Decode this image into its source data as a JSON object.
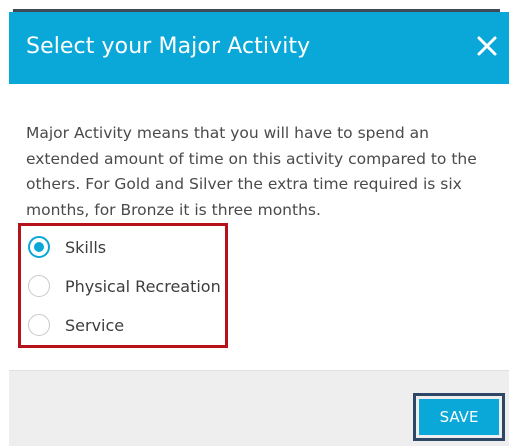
{
  "dialog": {
    "title": "Select your Major Activity",
    "close_icon": "close-icon",
    "description": "Major Activity means that you will have to spend an extended amount of time on this activity compared to the others. For Gold and Silver the extra time required is six months, for Bronze it is three months.",
    "options": [
      {
        "label": "Skills",
        "selected": true
      },
      {
        "label": "Physical Recreation",
        "selected": false
      },
      {
        "label": "Service",
        "selected": false
      }
    ],
    "save_label": "SAVE"
  },
  "colors": {
    "header": "#0aa8d8",
    "highlight_red": "#b5121b",
    "highlight_navy": "#2f4766",
    "footer": "#eeeeee"
  }
}
